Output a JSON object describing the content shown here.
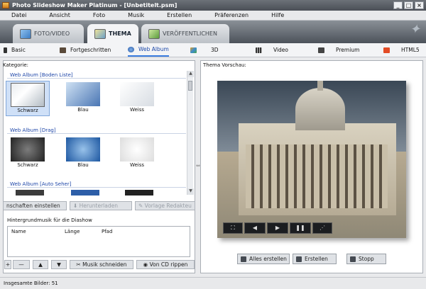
{
  "window": {
    "title": "Photo Slideshow Maker Platinum - [Unbetitelt.psm]",
    "controls": [
      "_",
      "□",
      "×"
    ]
  },
  "menu": [
    "Datei",
    "Ansicht",
    "Foto",
    "Musik",
    "Erstellen",
    "Präferenzen",
    "Hilfe"
  ],
  "main_tabs": [
    {
      "label": "FOTO/VIDEO",
      "icon": "photo-video-icon",
      "active": false
    },
    {
      "label": "THEMA",
      "icon": "theme-icon",
      "active": true
    },
    {
      "label": "VERÖFFENTLICHEN",
      "icon": "publish-icon",
      "active": false
    }
  ],
  "sub_tabs": [
    {
      "label": "Basic",
      "icon": "basic-icon"
    },
    {
      "label": "Fortgeschritten",
      "icon": "camera-icon"
    },
    {
      "label": "Web Album",
      "icon": "web-album-icon",
      "active": true
    },
    {
      "label": "3D",
      "icon": "3d-icon"
    },
    {
      "label": "Video",
      "icon": "film-icon"
    },
    {
      "label": "Premium",
      "icon": "premium-icon"
    },
    {
      "label": "HTML5",
      "icon": "html5-icon"
    }
  ],
  "left": {
    "category_label": "Kategorie:",
    "groups": [
      {
        "title": "Web Album [Boden Liste]",
        "items": [
          "Schwarz",
          "Blau",
          "Weiss"
        ]
      },
      {
        "title": "Web Album [Drag]",
        "items": [
          "Schwarz",
          "Blau",
          "Weiss"
        ]
      },
      {
        "title": "Web Album [Auto Seher]",
        "items": []
      }
    ],
    "selected": "Schwarz",
    "actions": [
      {
        "label": "nschaften einstellen",
        "disabled": false
      },
      {
        "label": "Herunterladen",
        "disabled": true
      },
      {
        "label": "Vorlage Redakteu",
        "disabled": true
      }
    ]
  },
  "music": {
    "title": "Hintergrundmusik für die Diashow",
    "columns": [
      "Name",
      "Länge",
      "Pfad"
    ],
    "buttons": [
      "Musik schneiden",
      "Von CD rippen"
    ]
  },
  "right": {
    "label": "Thema Vorschau:",
    "preview_controls": [
      "⛶",
      "◀",
      "▶",
      "❚❚",
      "⋰"
    ],
    "buttons": [
      "Alles erstellen",
      "Erstellen",
      "Stopp"
    ]
  },
  "status": "Insgesamte Bilder: 51"
}
